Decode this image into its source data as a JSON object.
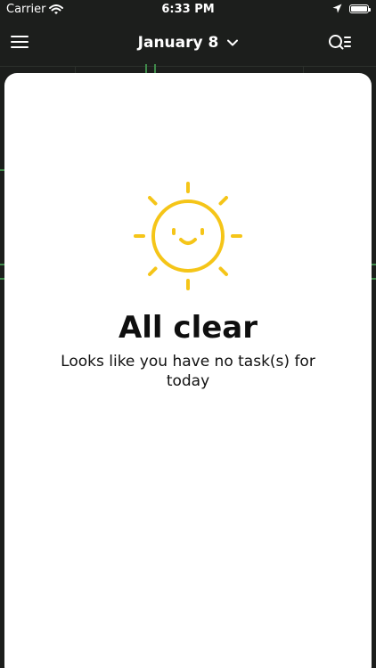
{
  "status_bar": {
    "carrier": "Carrier",
    "time": "6:33 PM",
    "battery_level": 1.0
  },
  "nav": {
    "menu_icon": "hamburger-icon",
    "title": "January 8",
    "title_icon": "chevron-down-icon",
    "action_icon": "search-list-icon"
  },
  "empty_state": {
    "icon": "smiling-sun-icon",
    "title": "All clear",
    "message": "Looks like you have no task(s) for today"
  },
  "colors": {
    "background": "#1c1e1c",
    "card": "#ffffff",
    "sun": "#f5c518",
    "text": "#0f0f0f",
    "accent_green": "#3f8a4a"
  }
}
